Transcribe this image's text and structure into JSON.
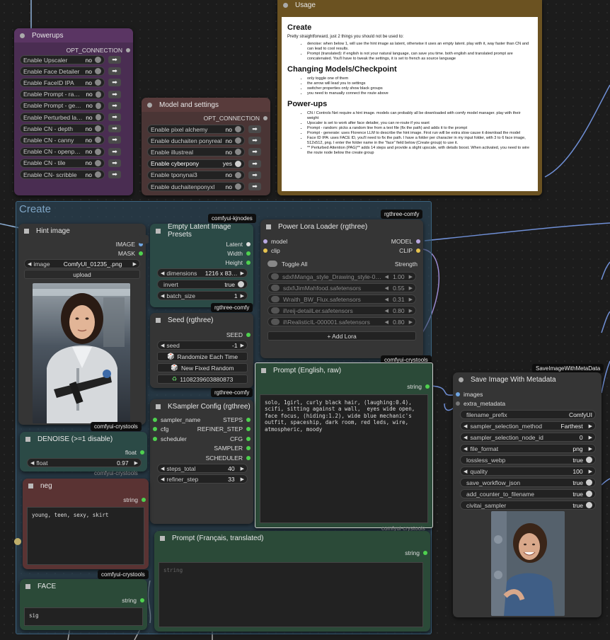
{
  "powerups": {
    "title": "Powerups",
    "output_label": "OPT_CONNECTION",
    "rows": [
      {
        "label": "Enable Upscaler",
        "value": "no"
      },
      {
        "label": "Enable Face Detailer",
        "value": "no"
      },
      {
        "label": "Enable FaceID IPA",
        "value": "no"
      },
      {
        "label": "Enable Prompt - random",
        "value": "no"
      },
      {
        "label": "Enable Prompt - gener…",
        "value": "no"
      },
      {
        "label": "Enable Perturbed late…",
        "value": "no"
      },
      {
        "label": "Enable CN - depth",
        "value": "no"
      },
      {
        "label": "Enable CN - canny",
        "value": "no"
      },
      {
        "label": "Enable CN - openpose",
        "value": "no"
      },
      {
        "label": "Enable CN - tile",
        "value": "no"
      },
      {
        "label": "Enable CN- scribble",
        "value": "no"
      }
    ]
  },
  "model_settings": {
    "title": "Model and settings",
    "output_label": "OPT_CONNECTION",
    "rows": [
      {
        "label": "Enable pixel alchemy",
        "value": "no"
      },
      {
        "label": "Enable duchaiten ponyreal",
        "value": "no"
      },
      {
        "label": "Enable illustreal",
        "value": "no"
      },
      {
        "label": "Enable cyberpony",
        "value": "yes"
      },
      {
        "label": "Enable tponynai3",
        "value": "no"
      },
      {
        "label": "Enable duchaitenponyxl",
        "value": "no"
      }
    ]
  },
  "usage": {
    "title": "Usage",
    "create_heading": "Create",
    "create_intro": "Pretty straightforward, just 2 things you should not be used to:",
    "create_items": [
      "denoise: when below 1, will use the hint image as latent, otherwise it uses an empty latent. play with it, way faster than CN and can lead to cool results.",
      "Prompt (translated): if english is not your natural language, can save you time. both english and translated prompt are concatenated. You'll have to tweak the settings, it is set to french as source language"
    ],
    "models_heading": "Changing Models/Checkpoint",
    "models_items": [
      "only toggle one of them",
      "the arrow will lead you to settings",
      "switcher properties only show black groups",
      "you need to manually connect the route above"
    ],
    "powerups_heading": "Power-ups",
    "powerups_items": [
      "CN / Controls Net require a hint image. models can probably all be downloaded with comfy model manager. play with their weight",
      "Upscaler is set to work after face detailer, you can re-route if you want",
      "Prompt - random: picks a random line from a text file (fix the path) and adds it to the prompt",
      "Prompt - generate: uses Florence LLM to describe the hint image. First run will be extra slow cause it download the model",
      "Face ID IPA: uses FACE ID, you'll need to fix the path. I have a folder per character in my input folder, with 3 to 6 face image, 512x512, png. I enter the folder name in the \"face\" field below (Create group) to use it.",
      "** Perturbed Attention (PAG)** adds 14 steps and provide a slight upscale, with details boost. When activated, you need to wire the route node below the create group"
    ]
  },
  "create_group": {
    "title": "Create"
  },
  "hint_image": {
    "title": "Hint image",
    "outputs": [
      "IMAGE",
      "MASK"
    ],
    "image_label": "image",
    "image_value": "ComfyUI_01235_.png",
    "upload_label": "upload"
  },
  "empty_latent": {
    "title": "Empty Latent Image Presets",
    "outputs": [
      "Latent",
      "Width",
      "Height"
    ],
    "widgets": [
      {
        "label": "dimensions",
        "value": "1216 x 83…"
      },
      {
        "label": "invert",
        "value": "true"
      },
      {
        "label": "batch_size",
        "value": "1"
      }
    ],
    "badge": "rgthree-comfy"
  },
  "seed": {
    "title": "Seed (rgthree)",
    "output": "SEED",
    "seed_label": "seed",
    "seed_value": "-1",
    "randomize_label": "Randomize Each Time",
    "new_fixed_label": "New Fixed Random",
    "last_seed": "1108239603880873",
    "badge": "rgthree-comfy"
  },
  "lora": {
    "title": "Power Lora Loader (rgthree)",
    "inputs": [
      "model",
      "clip"
    ],
    "outputs": [
      "MODEL",
      "CLIP"
    ],
    "toggle_all": "Toggle All",
    "strength_header": "Strength",
    "loras": [
      {
        "name": "sdxl\\Manga_style_Drawing_style-0000…",
        "strength": "1.00"
      },
      {
        "name": "sdxl\\JimMahfood.safetensors",
        "strength": "0.55"
      },
      {
        "name": "Wraith_BW_Flux.safetensors",
        "strength": "0.31"
      },
      {
        "name": "il\\reij-detailLer.safetensors",
        "strength": "0.80"
      },
      {
        "name": "il\\RealisticIL-000001.safetensors",
        "strength": "0.80"
      }
    ],
    "add_label": "+ Add Lora",
    "badge": "rgthree-comfy"
  },
  "badges": {
    "kjnodes": "comfyui-kjnodes",
    "crystools": "comfyui-crystools",
    "meta": "SaveImageWithMetaData"
  },
  "prompt_en": {
    "title": "Prompt (English, raw)",
    "output": "string",
    "text": "solo, 1girl, curly black hair, (laughing:0.4), scifi, sitting against a wall,  eyes wide open, face focus, (hiding:1.2), wide blue mechanic's outfit, spaceship, dark room, red leds, wire, atmospheric, moody"
  },
  "ksampler": {
    "title": "KSampler Config (rgthree)",
    "outputs": [
      "STEPS",
      "REFINER_STEP",
      "CFG",
      "SAMPLER",
      "SCHEDULER"
    ],
    "inputs": [
      "sampler_name",
      "cfg",
      "scheduler"
    ],
    "widgets": [
      {
        "label": "steps_total",
        "value": "40"
      },
      {
        "label": "refiner_step",
        "value": "33"
      }
    ]
  },
  "denoise": {
    "title": "DENOISE (>=1 disable)",
    "output": "float",
    "label": "float",
    "value": "0.97"
  },
  "neg": {
    "title": "neg",
    "output": "string",
    "text": "young, teen, sexy, skirt"
  },
  "face": {
    "title": "FACE",
    "output": "string",
    "text": "sig"
  },
  "prompt_fr": {
    "title": "Prompt (Français, translated)",
    "output": "string",
    "placeholder": "string"
  },
  "save_image": {
    "title": "Save Image With Metadata",
    "inputs": [
      "images",
      "extra_metadata"
    ],
    "widgets": [
      {
        "label": "filename_prefix",
        "value": "ComfyUI"
      },
      {
        "label": "sampler_selection_method",
        "value": "Farthest"
      },
      {
        "label": "sampler_selection_node_id",
        "value": "0"
      },
      {
        "label": "file_format",
        "value": "png"
      },
      {
        "label": "lossless_webp",
        "value": "true"
      },
      {
        "label": "quality",
        "value": "100"
      },
      {
        "label": "save_workflow_json",
        "value": "true"
      },
      {
        "label": "add_counter_to_filename",
        "value": "true"
      },
      {
        "label": "civitai_sampler",
        "value": "true"
      }
    ]
  },
  "colors": {
    "powerups_bg": "#4a2d52",
    "model_bg": "#4a3535",
    "usage_border": "#6b5221",
    "create_group": "#2f4e64",
    "green_node": "#2b4a38",
    "red_node": "#5a3333",
    "wire_blue": "#6f8fd6",
    "wire_purple": "#9a8ad1"
  }
}
